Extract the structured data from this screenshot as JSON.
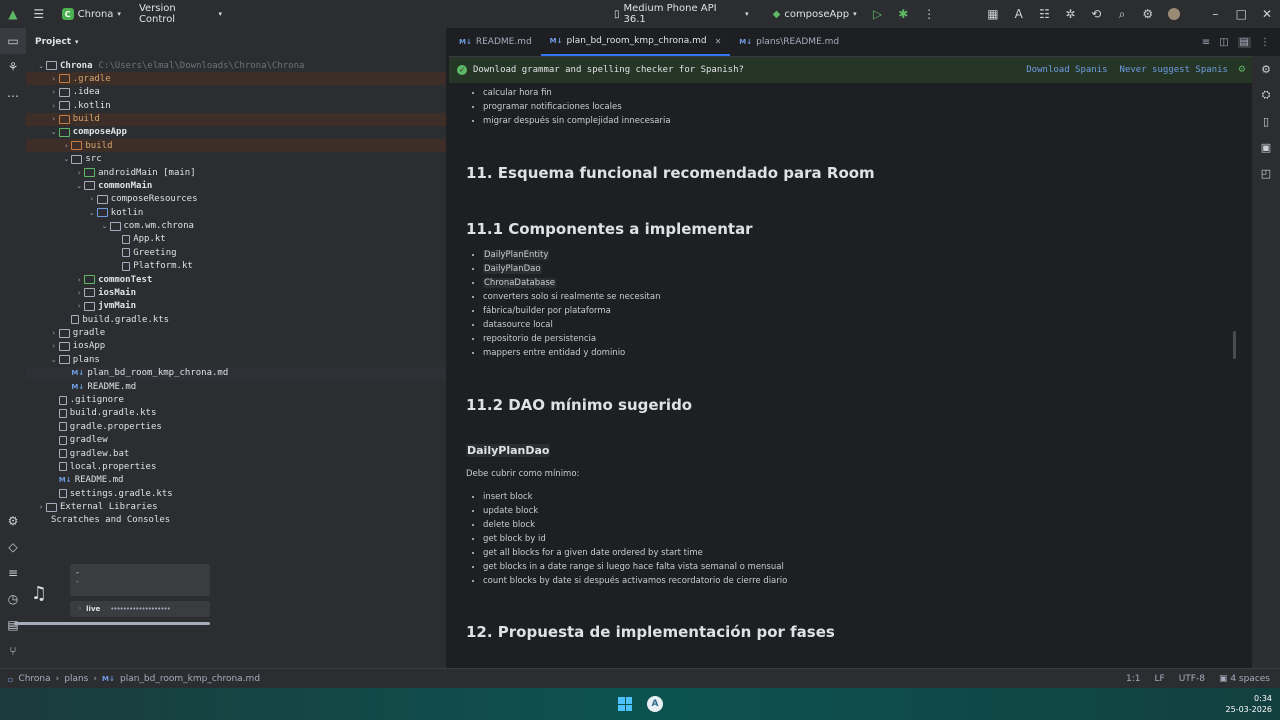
{
  "titlebar": {
    "project_initial": "C",
    "project_name": "Chrona",
    "vcs": "Version Control",
    "device": "Medium Phone API 36.1",
    "run_config": "composeApp"
  },
  "project_panel": {
    "title": "Project",
    "root_path": "C:\\Users\\elmal\\Downloads\\Chrona\\Chrona",
    "tree": [
      {
        "label": "Chrona",
        "depth": 0,
        "arrow": "v",
        "icon": "folder",
        "style": "bold",
        "excluded": false
      },
      {
        "label": ".gradle",
        "depth": 1,
        "arrow": ">",
        "icon": "folder-orange",
        "style": "orange",
        "excluded": true
      },
      {
        "label": ".idea",
        "depth": 1,
        "arrow": ">",
        "icon": "folder",
        "style": "",
        "excluded": false
      },
      {
        "label": ".kotlin",
        "depth": 1,
        "arrow": ">",
        "icon": "folder",
        "style": "",
        "excluded": false
      },
      {
        "label": "build",
        "depth": 1,
        "arrow": ">",
        "icon": "folder-orange",
        "style": "orange",
        "excluded": true
      },
      {
        "label": "composeApp",
        "depth": 1,
        "arrow": "v",
        "icon": "folder-green",
        "style": "bold",
        "excluded": false
      },
      {
        "label": "build",
        "depth": 2,
        "arrow": ">",
        "icon": "folder-orange",
        "style": "orange",
        "excluded": true
      },
      {
        "label": "src",
        "depth": 2,
        "arrow": "v",
        "icon": "folder",
        "style": "",
        "excluded": false
      },
      {
        "label": "androidMain [main]",
        "depth": 3,
        "arrow": ">",
        "icon": "folder-green",
        "style": "",
        "excluded": false
      },
      {
        "label": "commonMain",
        "depth": 3,
        "arrow": "v",
        "icon": "folder",
        "style": "bold",
        "excluded": false
      },
      {
        "label": "composeResources",
        "depth": 4,
        "arrow": ">",
        "icon": "folder",
        "style": "",
        "excluded": false
      },
      {
        "label": "kotlin",
        "depth": 4,
        "arrow": "v",
        "icon": "folder-blue",
        "style": "",
        "excluded": false
      },
      {
        "label": "com.wm.chrona",
        "depth": 5,
        "arrow": "v",
        "icon": "folder",
        "style": "",
        "excluded": false
      },
      {
        "label": "App.kt",
        "depth": 6,
        "arrow": "",
        "icon": "file",
        "style": "",
        "excluded": false
      },
      {
        "label": "Greeting",
        "depth": 6,
        "arrow": "",
        "icon": "file",
        "style": "",
        "excluded": false
      },
      {
        "label": "Platform.kt",
        "depth": 6,
        "arrow": "",
        "icon": "file",
        "style": "",
        "excluded": false
      },
      {
        "label": "commonTest",
        "depth": 3,
        "arrow": ">",
        "icon": "folder-green",
        "style": "bold",
        "excluded": false
      },
      {
        "label": "iosMain",
        "depth": 3,
        "arrow": ">",
        "icon": "folder",
        "style": "bold",
        "excluded": false
      },
      {
        "label": "jvmMain",
        "depth": 3,
        "arrow": ">",
        "icon": "folder",
        "style": "bold",
        "excluded": false
      },
      {
        "label": "build.gradle.kts",
        "depth": 2,
        "arrow": "",
        "icon": "file",
        "style": "",
        "excluded": false
      },
      {
        "label": "gradle",
        "depth": 1,
        "arrow": ">",
        "icon": "folder",
        "style": "",
        "excluded": false
      },
      {
        "label": "iosApp",
        "depth": 1,
        "arrow": ">",
        "icon": "folder",
        "style": "",
        "excluded": false
      },
      {
        "label": "plans",
        "depth": 1,
        "arrow": "v",
        "icon": "folder",
        "style": "",
        "excluded": false
      },
      {
        "label": "plan_bd_room_kmp_chrona.md",
        "depth": 2,
        "arrow": "",
        "icon": "md",
        "style": "",
        "excluded": false,
        "selected": true
      },
      {
        "label": "README.md",
        "depth": 2,
        "arrow": "",
        "icon": "md",
        "style": "",
        "excluded": false
      },
      {
        "label": ".gitignore",
        "depth": 1,
        "arrow": "",
        "icon": "file",
        "style": "",
        "excluded": false
      },
      {
        "label": "build.gradle.kts",
        "depth": 1,
        "arrow": "",
        "icon": "file",
        "style": "",
        "excluded": false
      },
      {
        "label": "gradle.properties",
        "depth": 1,
        "arrow": "",
        "icon": "file",
        "style": "",
        "excluded": false
      },
      {
        "label": "gradlew",
        "depth": 1,
        "arrow": "",
        "icon": "file",
        "style": "",
        "excluded": false
      },
      {
        "label": "gradlew.bat",
        "depth": 1,
        "arrow": "",
        "icon": "file",
        "style": "",
        "excluded": false
      },
      {
        "label": "local.properties",
        "depth": 1,
        "arrow": "",
        "icon": "file",
        "style": "",
        "excluded": false
      },
      {
        "label": "README.md",
        "depth": 1,
        "arrow": "",
        "icon": "md",
        "style": "",
        "excluded": false
      },
      {
        "label": "settings.gradle.kts",
        "depth": 1,
        "arrow": "",
        "icon": "file",
        "style": "",
        "excluded": false
      },
      {
        "label": "External Libraries",
        "depth": 0,
        "arrow": ">",
        "icon": "lib",
        "style": "",
        "excluded": false
      },
      {
        "label": "Scratches and Consoles",
        "depth": 0,
        "arrow": "",
        "icon": "none",
        "style": "",
        "excluded": false
      }
    ]
  },
  "tabs": [
    {
      "label": "README.md",
      "active": false
    },
    {
      "label": "plan_bd_room_kmp_chrona.md",
      "active": true
    },
    {
      "label": "plans\\README.md",
      "active": false
    }
  ],
  "notification": {
    "text": "Download grammar and spelling checker for Spanish?",
    "action1": "Download Spanis",
    "action2": "Never suggest Spanis"
  },
  "preview": {
    "list_top": [
      "calcular hora fin",
      "programar notificaciones locales",
      "migrar después sin complejidad innecesaria"
    ],
    "h_11": "11. Esquema funcional recomendado para Room",
    "h_111": "11.1 Componentes a implementar",
    "components": [
      {
        "text": "DailyPlanEntity",
        "code": true
      },
      {
        "text": "DailyPlanDao",
        "code": true
      },
      {
        "text": "ChronaDatabase",
        "code": true
      },
      {
        "text": "converters solo si realmente se necesitan",
        "code": false
      },
      {
        "text": "fábrica/builder por plataforma",
        "code": false
      },
      {
        "text": "datasource local",
        "code": false
      },
      {
        "text": "repositorio de persistencia",
        "code": false
      },
      {
        "text": "mappers entre entidad y dominio",
        "code": false
      }
    ],
    "h_112": "11.2 DAO mínimo sugerido",
    "dao_title": "DailyPlanDao",
    "dao_intro": "Debe cubrir como mínimo:",
    "dao_list": [
      "insert block",
      "update block",
      "delete block",
      "get block by id",
      "get all blocks for a given date ordered by start time",
      "get blocks in a date range si luego hace falta vista semanal o mensual",
      "count blocks by date si después activamos recordatorio de cierre diario"
    ],
    "h_12": "12. Propuesta de implementación por fases"
  },
  "media_widget": {
    "title": "-",
    "subtitle": "-",
    "live": "live",
    "icon": "music-note-icon"
  },
  "statusbar": {
    "crumbs": [
      "Chrona",
      "plans",
      "plan_bd_room_kmp_chrona.md"
    ],
    "position": "1:1",
    "line_sep": "LF",
    "encoding": "UTF-8",
    "indent": "4 spaces"
  },
  "taskbar": {
    "time": "0:34",
    "date": "25-03-2026"
  }
}
